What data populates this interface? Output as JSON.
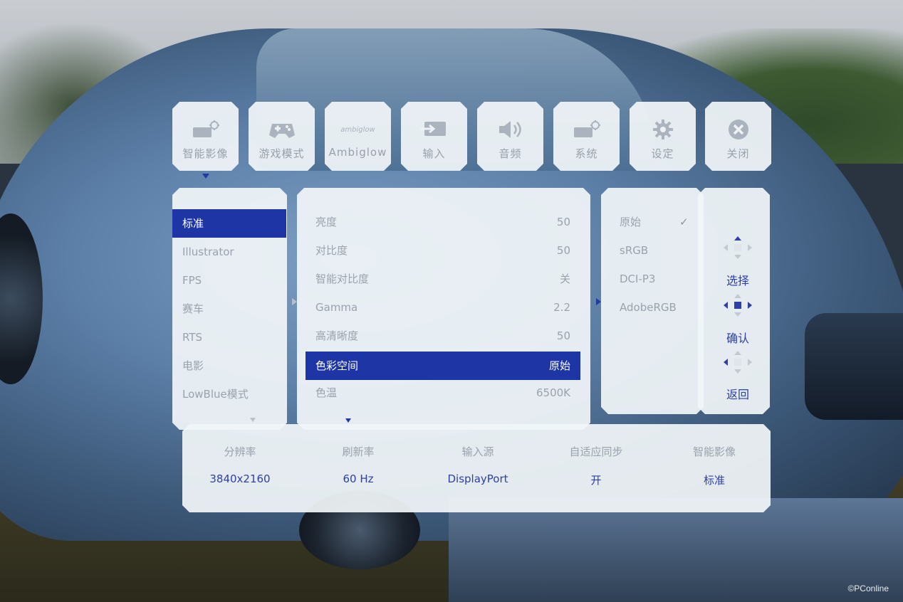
{
  "colors": {
    "accent": "#1e35a6",
    "panel": "#f1f5f8",
    "muted_text": "#9aa2ad"
  },
  "tabs": [
    {
      "label": "智能影像",
      "icon": "smart-image-icon"
    },
    {
      "label": "游戏模式",
      "icon": "gamepad-icon"
    },
    {
      "label": "Ambiglow",
      "icon": "ambiglow-logo-icon",
      "icon_text": "ambiglow"
    },
    {
      "label": "输入",
      "icon": "input-icon"
    },
    {
      "label": "音频",
      "icon": "speaker-icon"
    },
    {
      "label": "系统",
      "icon": "system-icon"
    },
    {
      "label": "设定",
      "icon": "gear-icon"
    },
    {
      "label": "关闭",
      "icon": "close-icon"
    }
  ],
  "presets": {
    "selected_index": 0,
    "items": [
      "标准",
      "Illustrator",
      "FPS",
      "赛车",
      "RTS",
      "电影",
      "LowBlue模式"
    ]
  },
  "settings": {
    "selected_index": 5,
    "items": [
      {
        "label": "亮度",
        "value": "50"
      },
      {
        "label": "对比度",
        "value": "50"
      },
      {
        "label": "智能对比度",
        "value": "关"
      },
      {
        "label": "Gamma",
        "value": "2.2"
      },
      {
        "label": "高清晰度",
        "value": "50"
      },
      {
        "label": "色彩空间",
        "value": "原始"
      },
      {
        "label": "色温",
        "value": "6500K"
      }
    ]
  },
  "color_space": {
    "items": [
      "原始",
      "sRGB",
      "DCI-P3",
      "AdobeRGB"
    ],
    "checked_index": 0,
    "check_mark": "✓"
  },
  "controls": [
    {
      "label": "选择",
      "icon": "four-way-dpad-icon"
    },
    {
      "label": "确认",
      "icon": "dpad-center-icon"
    },
    {
      "label": "返回",
      "icon": "dpad-left-icon"
    }
  ],
  "info_bar": {
    "headers": [
      "分辨率",
      "刷新率",
      "输入源",
      "自适应同步",
      "智能影像"
    ],
    "values": [
      "3840x2160",
      "60 Hz",
      "DisplayPort",
      "开",
      "标准"
    ]
  },
  "watermark": "©PConline"
}
